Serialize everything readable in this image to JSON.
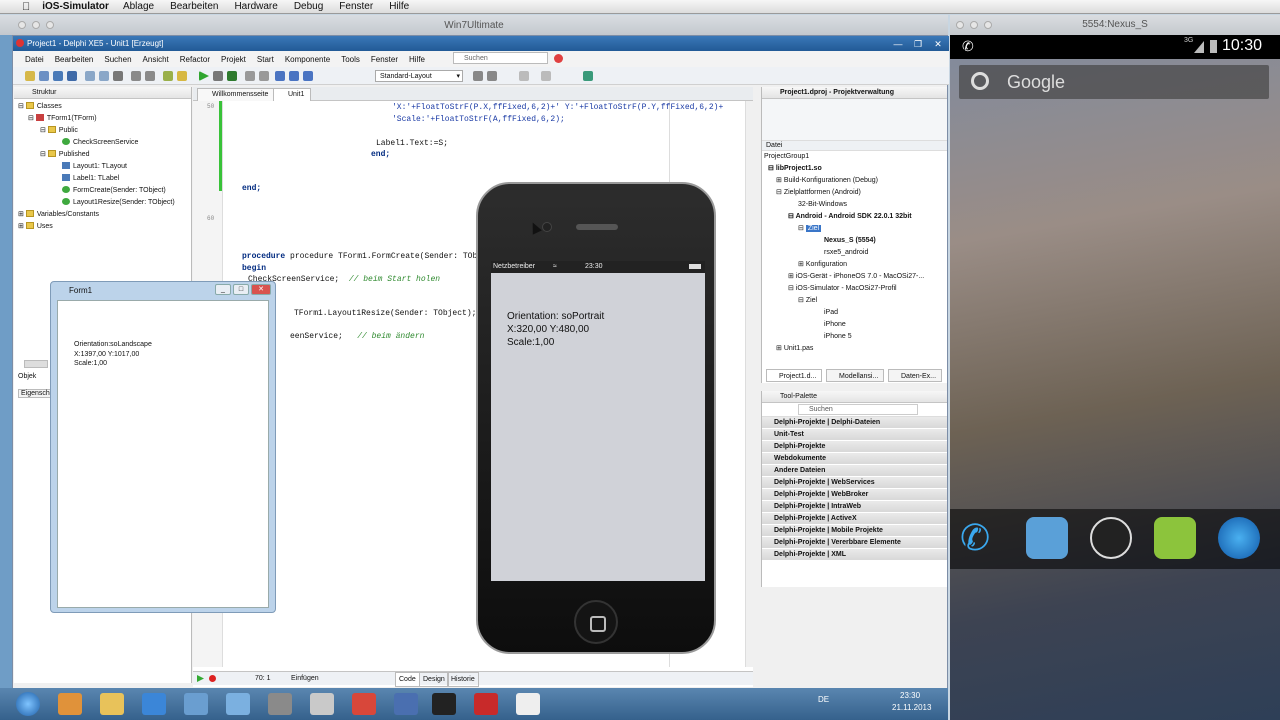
{
  "mac_menu": {
    "app": "iOS-Simulator",
    "items": [
      "Ablage",
      "Bearbeiten",
      "Hardware",
      "Debug",
      "Fenster",
      "Hilfe"
    ]
  },
  "vm": {
    "title": "Win7Ultimate"
  },
  "delphi": {
    "title": "Project1 - Delphi XE5 - Unit1 [Erzeugt]",
    "menu": [
      "Datei",
      "Bearbeiten",
      "Suchen",
      "Ansicht",
      "Refactor",
      "Projekt",
      "Start",
      "Komponente",
      "Tools",
      "Fenster",
      "Hilfe"
    ],
    "search_placeholder": "Suchen",
    "layout": "Standard-Layout",
    "structure": {
      "title": "Struktur",
      "items": [
        "Classes",
        "TForm1(TForm)",
        "Public",
        "CheckScreenService",
        "Published",
        "Layout1: TLayout",
        "Label1: TLabel",
        "FormCreate(Sender: TObject)",
        "Layout1Resize(Sender: TObject)",
        "Variables/Constants",
        "Uses"
      ]
    },
    "left_tabs": [
      "Objek",
      "Eigensch"
    ],
    "editor": {
      "tabs": [
        "Willkommensseite",
        "Unit1"
      ],
      "line_numbers": [
        "50",
        "60"
      ],
      "code": [
        "'X:'+FloatToStrF(P.X,ffFixed,6,2)+' Y:'+FloatToStrF(P.Y,ffFixed,6,2)+",
        "'Scale:'+FloatToStrF(A,ffFixed,6,2);",
        "Label1.Text:=S;",
        "end;",
        "end;",
        "procedure TForm1.FormCreate(Sender: TObject);",
        "begin",
        "CheckScreenService;",
        "// beim Start holen",
        "TForm1.Layout1Resize(Sender: TObject);",
        "eenService;",
        "// beim ändern"
      ],
      "status": {
        "pos": "70:  1",
        "mode": "Einfügen",
        "tabs": [
          "Code",
          "Design",
          "Historie"
        ]
      }
    },
    "project": {
      "title": "Project1.dproj - Projektverwaltung",
      "header": "Datei",
      "items": [
        "ProjectGroup1",
        "libProject1.so",
        "Build-Konfigurationen (Debug)",
        "Zielplattformen (Android)",
        "32-Bit-Windows",
        "Android - Android SDK 22.0.1 32bit",
        "Ziel",
        "Nexus_S (5554)",
        "rsxe5_android",
        "Konfiguration",
        "iOS-Gerät - iPhoneOS 7.0 - MacOSi27-...",
        "iOS-Simulator - MacOSi27-Profil",
        "Ziel",
        "iPad",
        "iPhone",
        "iPhone 5",
        "Unit1.pas"
      ],
      "tabs": [
        "Project1.d...",
        "Modellansi...",
        "Daten-Ex..."
      ]
    },
    "palette": {
      "title": "Tool-Palette",
      "search": "Suchen",
      "categories": [
        "Delphi-Projekte | Delphi-Dateien",
        "Unit-Test",
        "Delphi-Projekte",
        "Webdokumente",
        "Andere Dateien",
        "Delphi-Projekte | WebServices",
        "Delphi-Projekte | WebBroker",
        "Delphi-Projekte | IntraWeb",
        "Delphi-Projekte | ActiveX",
        "Delphi-Projekte | Mobile Projekte",
        "Delphi-Projekte | Vererbbare Elemente",
        "Delphi-Projekte | XML"
      ]
    }
  },
  "form1": {
    "title": "Form1",
    "lines": [
      "Orientation:soLandscape",
      "X:1397,00  Y:1017,00",
      "Scale:1,00"
    ]
  },
  "taskbar": {
    "lang": "DE",
    "time": "23:30",
    "date": "21.11.2013"
  },
  "iphone": {
    "carrier": "Netzbetreiber",
    "time": "23:30",
    "lines": [
      "Orientation: soPortrait",
      "X:320,00 Y:480,00",
      "Scale:1,00"
    ]
  },
  "android": {
    "title": "5554:Nexus_S",
    "signal": "3G",
    "time": "10:30",
    "search": "Google"
  }
}
